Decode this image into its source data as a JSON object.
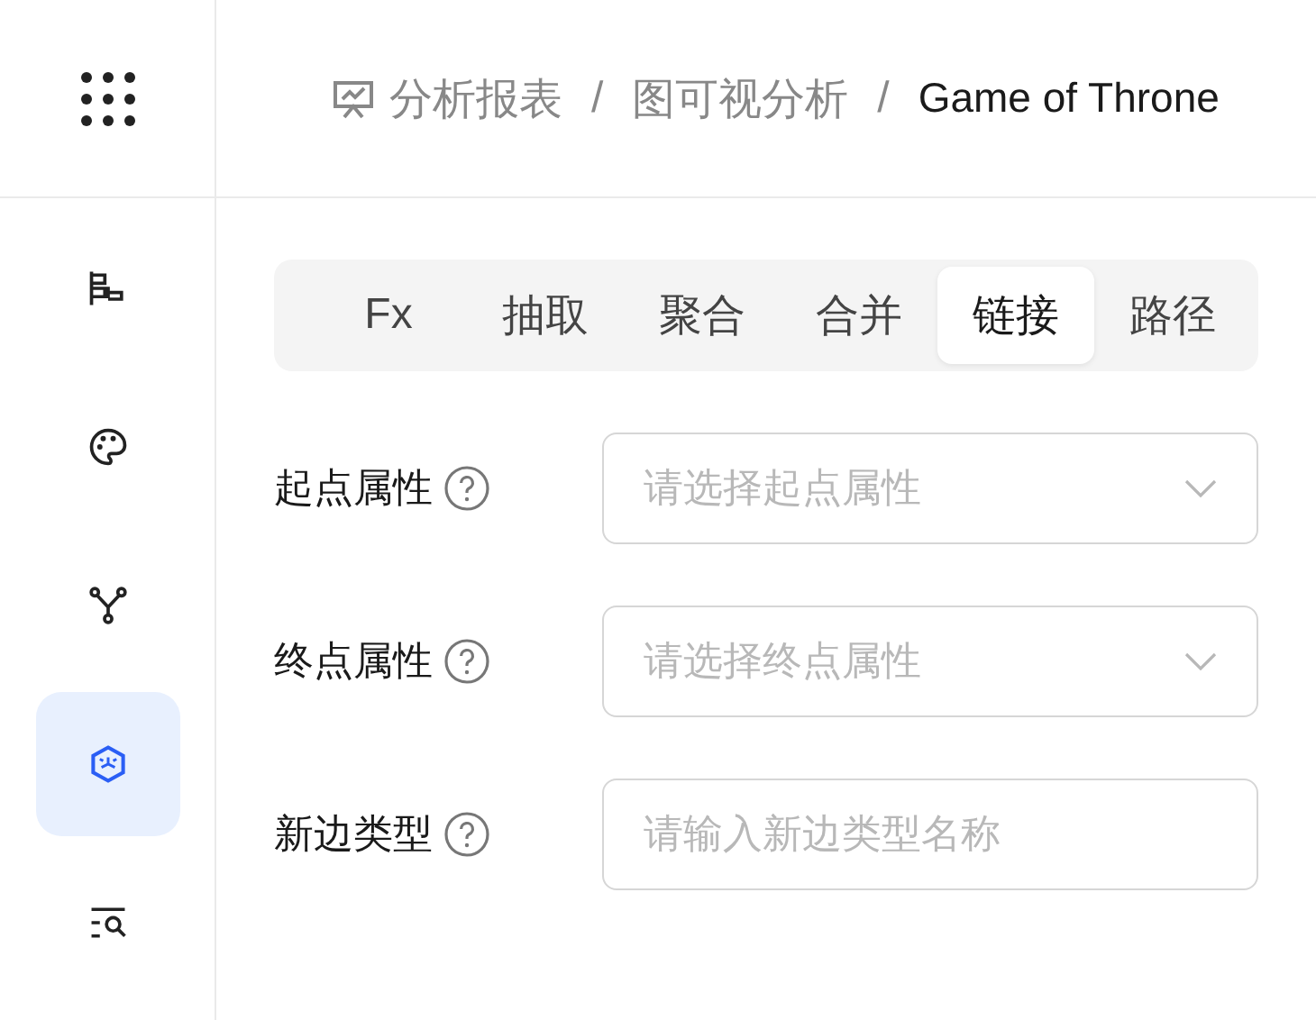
{
  "sidebar": {
    "items": [
      {
        "kind": "tree",
        "selected": false
      },
      {
        "kind": "palette",
        "selected": false
      },
      {
        "kind": "branch",
        "selected": false
      },
      {
        "kind": "cube",
        "selected": true
      },
      {
        "kind": "search-list",
        "selected": false
      }
    ]
  },
  "breadcrumb": [
    {
      "text": "分析报表"
    },
    {
      "separator": "/",
      "text": "图可视分析"
    },
    {
      "separator": "/",
      "text": "Game of Throne"
    }
  ],
  "tabs": [
    {
      "label": "Fx",
      "selected": false
    },
    {
      "label": "抽取",
      "selected": false
    },
    {
      "label": "聚合",
      "selected": false
    },
    {
      "label": "合并",
      "selected": false
    },
    {
      "label": "链接",
      "selected": true
    },
    {
      "label": "路径",
      "selected": false
    }
  ],
  "fields": [
    {
      "label": "起点属性",
      "kind": "select",
      "placeholder": "请选择起点属性"
    },
    {
      "label": "终点属性",
      "kind": "select",
      "placeholder": "请选择终点属性"
    },
    {
      "label": "新边类型",
      "kind": "input",
      "placeholder": "请输入新边类型名称"
    }
  ]
}
